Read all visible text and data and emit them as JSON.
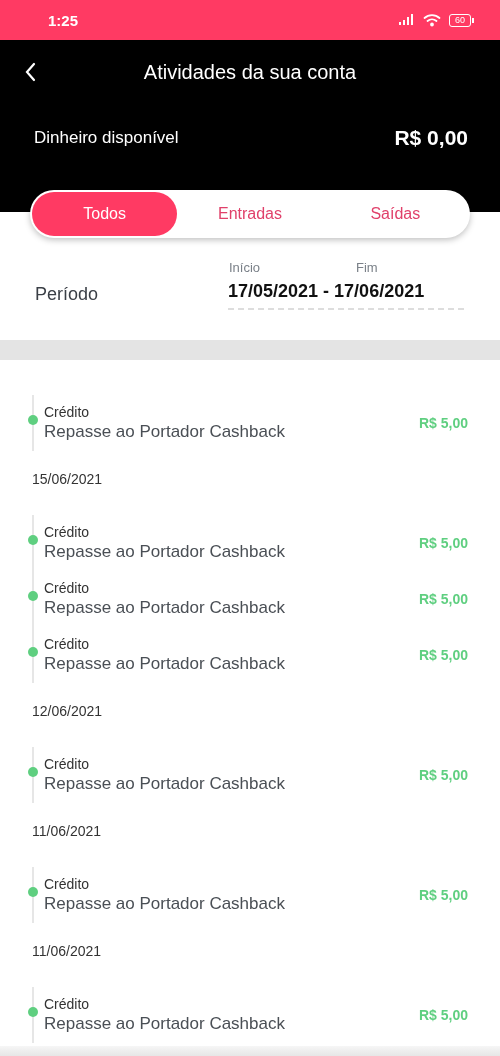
{
  "status_bar": {
    "time": "1:25",
    "battery": "60"
  },
  "header": {
    "title": "Atividades da sua conta",
    "balance_label": "Dinheiro disponível",
    "balance": "R$ 0,00"
  },
  "tabs": [
    {
      "label": "Todos",
      "selected": true
    },
    {
      "label": "Entradas",
      "selected": false
    },
    {
      "label": "Saídas",
      "selected": false
    }
  ],
  "period": {
    "label": "Período",
    "start_label": "Início",
    "end_label": "Fim",
    "start": "17/05/2021",
    "separator": "-",
    "end": "17/06/2021"
  },
  "groups": [
    {
      "entries": [
        {
          "type": "Crédito",
          "description": "Repasse ao Portador Cashback",
          "amount": "R$ 5,00",
          "color": "#5fcf80"
        }
      ]
    },
    {
      "date": "15/06/2021",
      "entries": [
        {
          "type": "Crédito",
          "description": "Repasse ao Portador Cashback",
          "amount": "R$ 5,00",
          "color": "#5fcf80"
        },
        {
          "type": "Crédito",
          "description": "Repasse ao Portador Cashback",
          "amount": "R$ 5,00",
          "color": "#5fcf80"
        },
        {
          "type": "Crédito",
          "description": "Repasse ao Portador Cashback",
          "amount": "R$ 5,00",
          "color": "#5fcf80"
        }
      ]
    },
    {
      "date": "12/06/2021",
      "entries": [
        {
          "type": "Crédito",
          "description": "Repasse ao Portador Cashback",
          "amount": "R$ 5,00",
          "color": "#5fcf80"
        }
      ]
    },
    {
      "date": "11/06/2021",
      "entries": [
        {
          "type": "Crédito",
          "description": "Repasse ao Portador Cashback",
          "amount": "R$ 5,00",
          "color": "#5fcf80"
        }
      ]
    },
    {
      "date": "11/06/2021",
      "entries": [
        {
          "type": "Crédito",
          "description": "Repasse ao Portador Cashback",
          "amount": "R$ 5,00",
          "color": "#5fcf80"
        }
      ]
    }
  ]
}
